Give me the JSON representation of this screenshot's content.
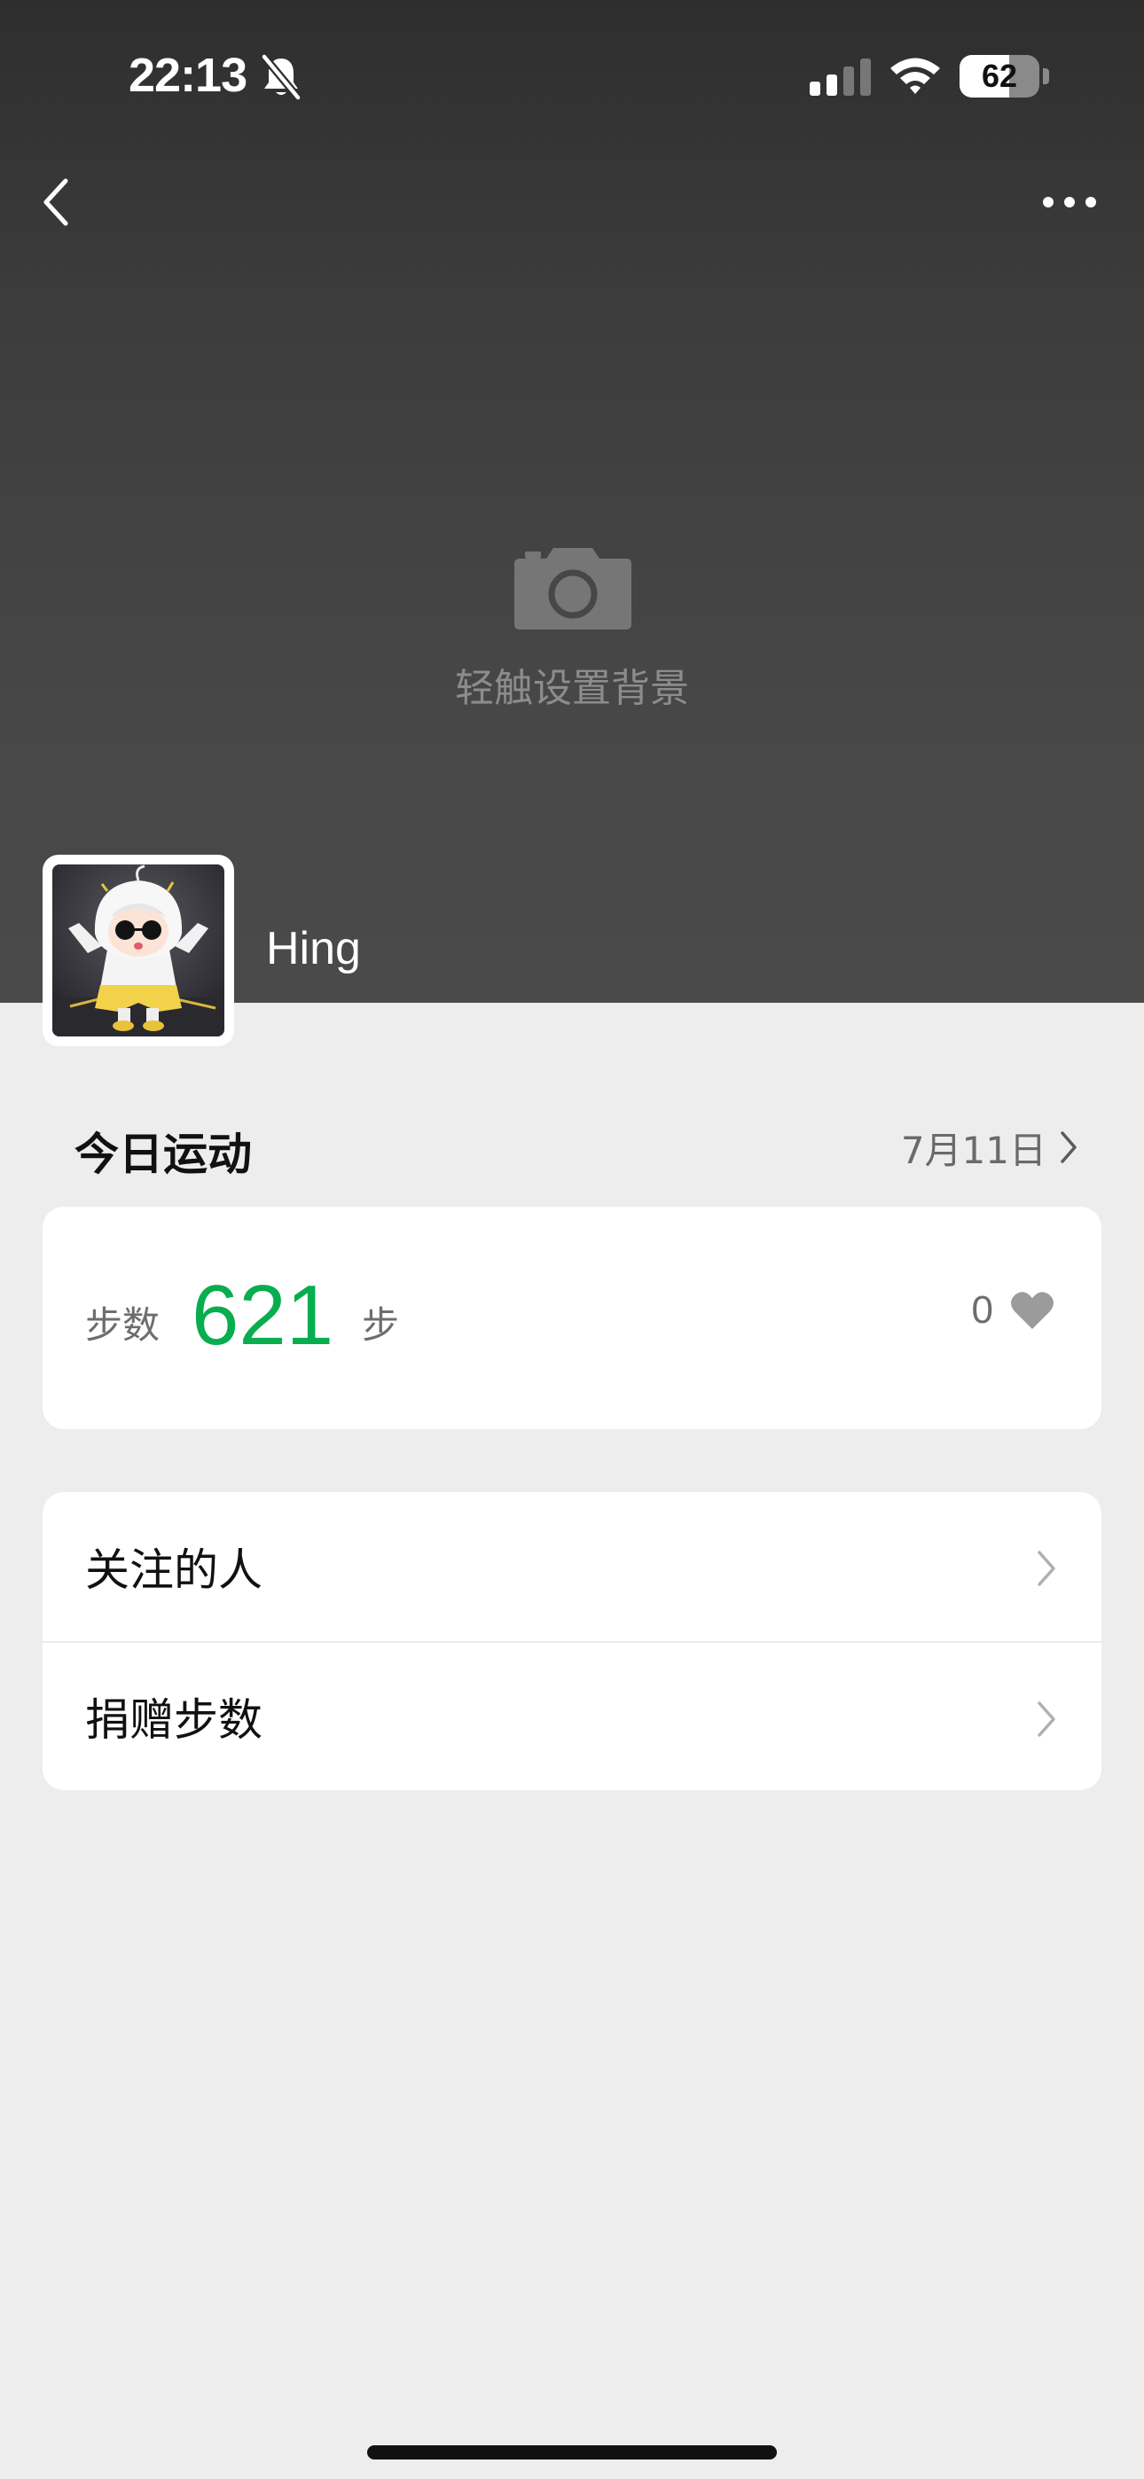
{
  "status_bar": {
    "time": "22:13",
    "battery_level": "62",
    "battery_fraction": 0.62,
    "icons": [
      "bell-slash-icon",
      "cellular-signal-icon",
      "wifi-icon",
      "battery-icon"
    ]
  },
  "nav": {
    "back_icon": "chevron-left-icon",
    "more_icon": "more-dots-icon"
  },
  "cover": {
    "icon": "camera-icon",
    "label": "轻触设置背景"
  },
  "profile": {
    "username": "Hing"
  },
  "today": {
    "title": "今日运动",
    "date": "7月11日",
    "steps_label": "步数",
    "steps_value": "621",
    "steps_unit": "步",
    "likes_count": "0"
  },
  "menu": {
    "items": [
      {
        "label": "关注的人"
      },
      {
        "label": "捐赠步数"
      }
    ]
  },
  "colors": {
    "accent": "#07ad4f",
    "background": "#ededed",
    "header": "#474747"
  }
}
